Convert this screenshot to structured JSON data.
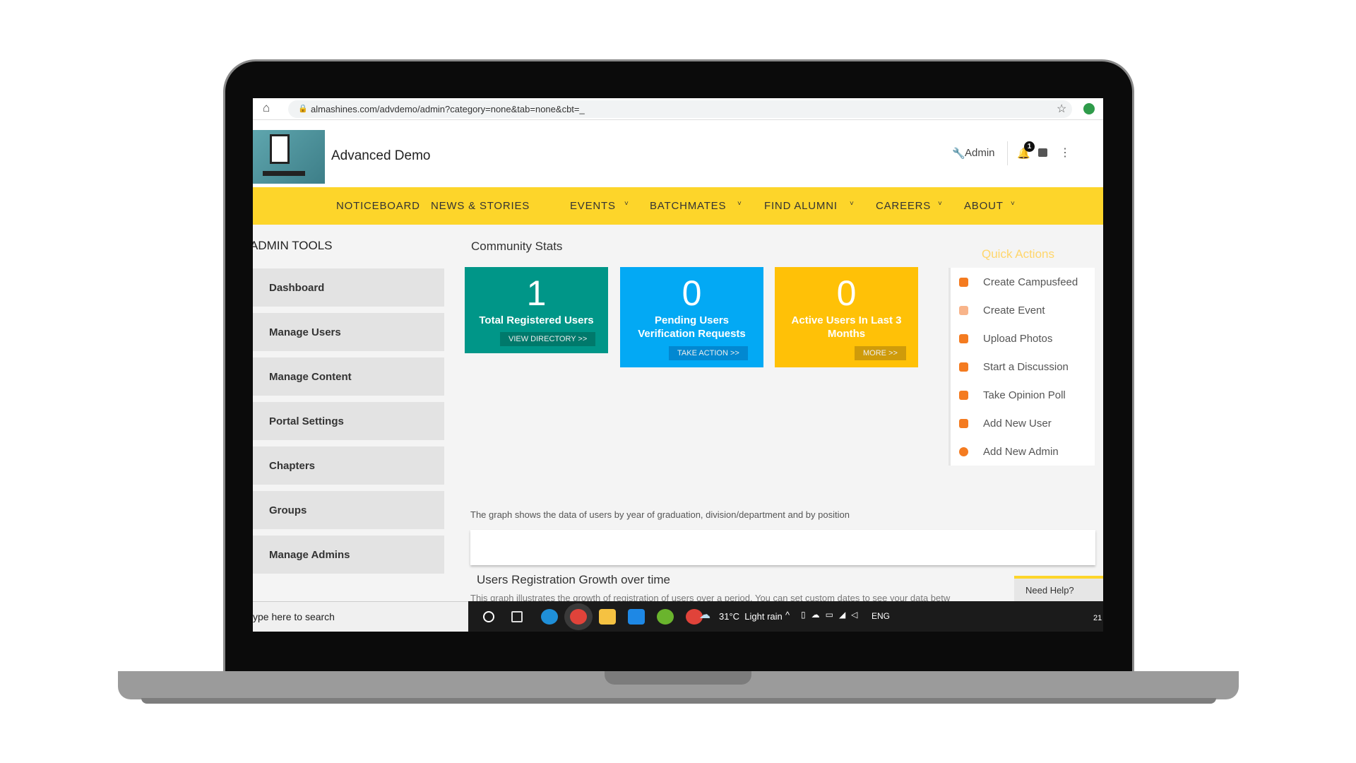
{
  "browser": {
    "url": "almashines.com/advdemo/admin?category=none&tab=none&cbt=_"
  },
  "header": {
    "site_title": "Advanced Demo",
    "admin_label": "Admin",
    "notification_count": "1"
  },
  "nav": [
    "NOTICEBOARD",
    "NEWS & STORIES",
    "EVENTS",
    "BATCHMATES",
    "FIND ALUMNI",
    "CAREERS",
    "ABOUT"
  ],
  "sidebar": {
    "title": "ADMIN TOOLS",
    "items": [
      "Dashboard",
      "Manage Users",
      "Manage Content",
      "Portal Settings",
      "Chapters",
      "Groups",
      "Manage Admins"
    ]
  },
  "stats": {
    "title": "Community Stats",
    "cards": [
      {
        "value": "1",
        "label": "Total Registered Users",
        "button": "VIEW DIRECTORY >>",
        "color": "#009688"
      },
      {
        "value": "0",
        "label": "Pending Users Verification Requests",
        "button": "TAKE ACTION >>",
        "color": "#03a9f4"
      },
      {
        "value": "0",
        "label": "Active Users In Last 3 Months",
        "button": "MORE >>",
        "color": "#ffc107"
      }
    ]
  },
  "quick_actions": {
    "title": "Quick Actions",
    "items": [
      "Create Campusfeed",
      "Create Event",
      "Upload Photos",
      "Start a Discussion",
      "Take Opinion Poll",
      "Add New User",
      "Add New Admin"
    ]
  },
  "graph_note": "The graph shows the data of users by year of graduation, division/department and by position",
  "growth": {
    "title": "Users Registration Growth over time",
    "desc": "This graph illustrates the growth of registration of users over a period. You can set custom dates to see your data betw"
  },
  "help": "Need Help?",
  "taskbar": {
    "search_placeholder": "ype here to search",
    "weather": "31°C  Light rain",
    "lang": "ENG",
    "clock": "21"
  }
}
